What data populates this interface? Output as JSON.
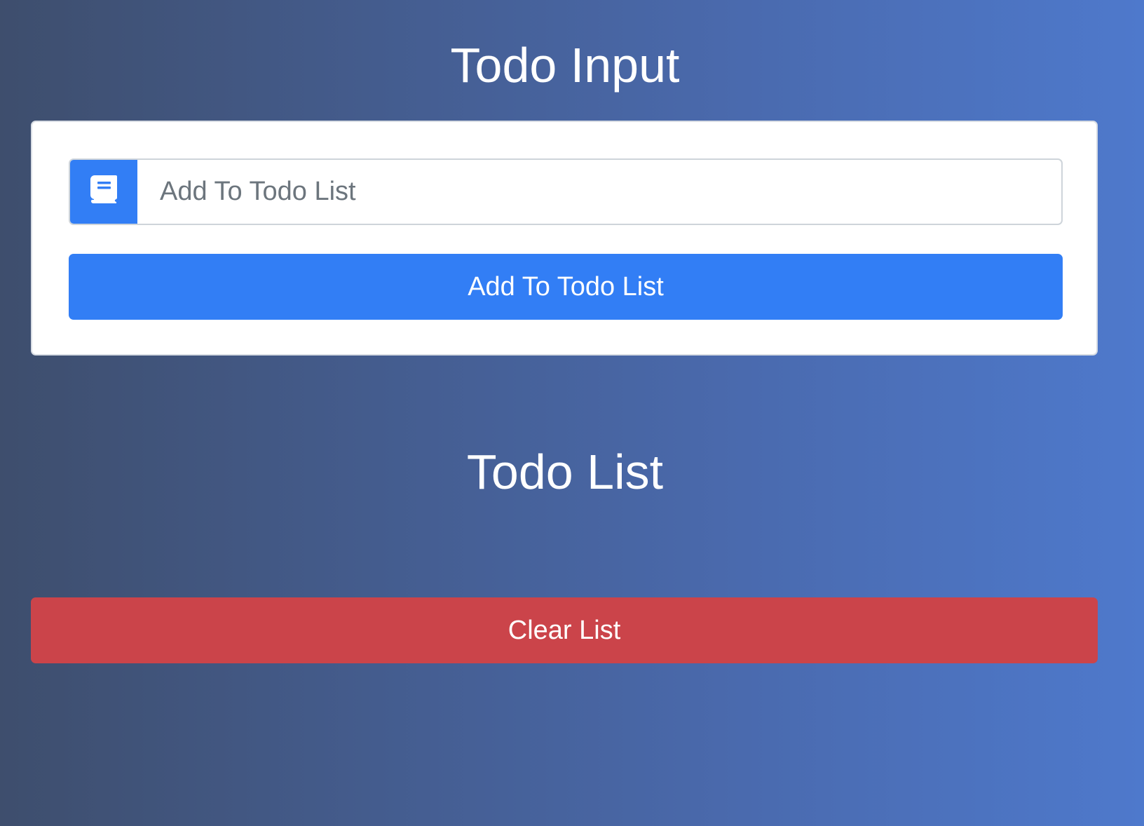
{
  "input_section": {
    "title": "Todo Input",
    "icon": "book-icon",
    "input_placeholder": "Add To Todo List",
    "input_value": "",
    "add_button_label": "Add To Todo List"
  },
  "list_section": {
    "title": "Todo List",
    "items": [],
    "clear_button_label": "Clear List"
  },
  "colors": {
    "primary": "#327ef5",
    "danger": "#cb444a",
    "background_start": "#3e4e6d",
    "background_end": "#4e79cc"
  }
}
